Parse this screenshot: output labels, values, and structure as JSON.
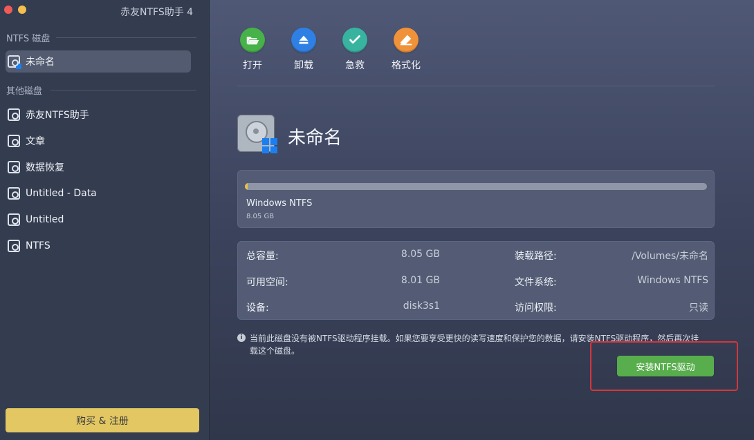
{
  "window": {
    "title": "赤友NTFS助手 4"
  },
  "sidebar": {
    "ntfs_section": "NTFS 磁盘",
    "ntfs_items": [
      {
        "label": "未命名",
        "active": true
      }
    ],
    "other_section": "其他磁盘",
    "other_items": [
      {
        "label": "赤友NTFS助手"
      },
      {
        "label": "文章"
      },
      {
        "label": "数据恢复"
      },
      {
        "label": "Untitled - Data"
      },
      {
        "label": "Untitled"
      },
      {
        "label": "NTFS"
      }
    ],
    "buy_button": "购买 & 注册"
  },
  "toolbar": {
    "items": [
      {
        "label": "打开",
        "icon": "folder-open-icon",
        "color": "#48b24a"
      },
      {
        "label": "卸载",
        "icon": "eject-icon",
        "color": "#2f80e5"
      },
      {
        "label": "急救",
        "icon": "check-icon",
        "color": "#38b3a0"
      },
      {
        "label": "格式化",
        "icon": "eraser-icon",
        "color": "#f0923a"
      }
    ]
  },
  "drive": {
    "name": "未命名",
    "filesystem": "Windows NTFS",
    "size": "8.05 GB",
    "used_fraction": 0.006
  },
  "info": {
    "rows": [
      {
        "k1": "总容量:",
        "v1": "8.05 GB",
        "k2": "装载路径:",
        "v2": "/Volumes/未命名"
      },
      {
        "k1": "可用空间:",
        "v1": "8.01 GB",
        "k2": "文件系统:",
        "v2": "Windows NTFS"
      },
      {
        "k1": "设备:",
        "v1": "disk3s1",
        "k2": "访问权限:",
        "v2": "只读"
      }
    ]
  },
  "notice": "当前此磁盘没有被NTFS驱动程序挂载。如果您要享受更快的读写速度和保护您的数据，请安装NTFS驱动程序，然后再次挂载这个磁盘。",
  "install_button": "安装NTFS驱动",
  "colors": {
    "accent_green": "#58ad4c",
    "buy_yellow": "#e2c762",
    "highlight_red": "#d6363b"
  }
}
